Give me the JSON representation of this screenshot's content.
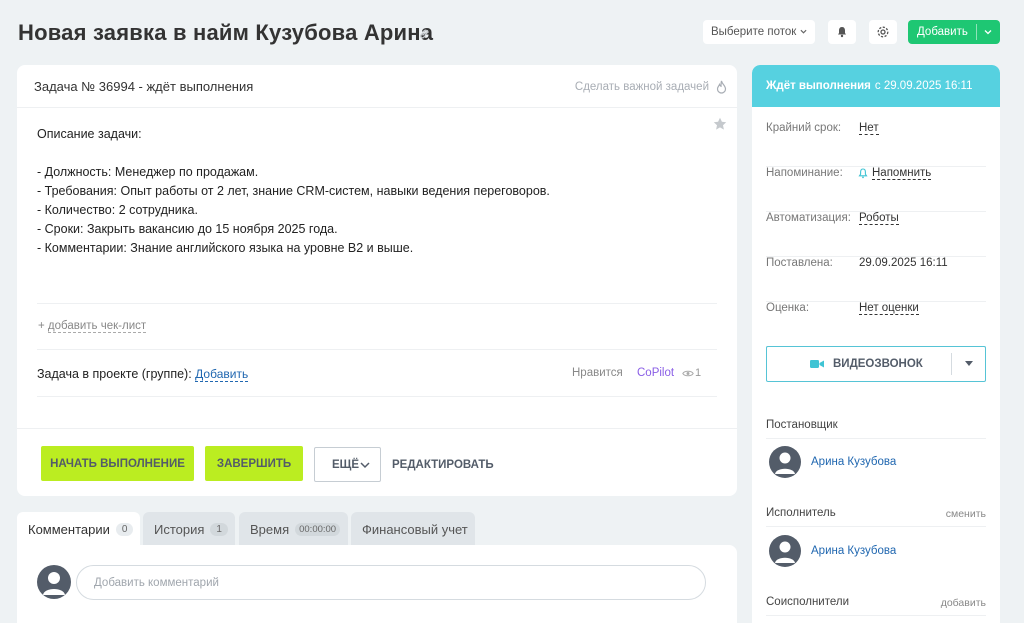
{
  "header": {
    "title": "Новая заявка в найм Кузубова Арина",
    "flow_select": "Выберите поток",
    "add_button": "Добавить"
  },
  "task": {
    "title": "Задача № 36994 - ждёт выполнения",
    "make_important": "Сделать важной задачей",
    "description": [
      "Описание задачи:",
      "",
      "- Должность: Менеджер по продажам.",
      "- Требования: Опыт работы от 2 лет, знание CRM-систем, навыки ведения переговоров.",
      "- Количество: 2 сотрудника.",
      "- Сроки: Закрыть вакансию до 15 ноября 2025 года.",
      "- Комментарии: Знание английского языка на уровне B2 и выше."
    ],
    "checklist_plus": "+",
    "checklist_link": "добавить чек-лист",
    "project_label": "Задача в проекте (группе):",
    "project_link": "Добавить",
    "likes": "Нравится",
    "copilot": "CoPilot",
    "views": "1",
    "buttons": {
      "start": "НАЧАТЬ ВЫПОЛНЕНИЕ",
      "finish": "ЗАВЕРШИТЬ",
      "more": "ЕЩЁ",
      "edit": "РЕДАКТИРОВАТЬ"
    }
  },
  "tabs": [
    {
      "label": "Комментарии",
      "badge": "0"
    },
    {
      "label": "История",
      "badge": "1"
    },
    {
      "label": "Время",
      "badge": "00:00:00"
    },
    {
      "label": "Финансовый учет",
      "badge": ""
    }
  ],
  "comment_placeholder": "Добавить комментарий",
  "sidebar": {
    "status_bold": "Ждёт выполнения",
    "status_rest": "с 29.09.2025 16:11",
    "props": [
      {
        "label": "Крайний срок:",
        "value": "Нет"
      },
      {
        "label": "Напоминание:",
        "value": "Напомнить"
      },
      {
        "label": "Автоматизация:",
        "value": "Роботы"
      },
      {
        "label": "Поставлена:",
        "value": "29.09.2025 16:11"
      },
      {
        "label": "Оценка:",
        "value": "Нет оценки"
      }
    ],
    "video_call": "ВИДЕОЗВОНОК",
    "creator_label": "Постановщик",
    "creator_name": "Арина Кузубова",
    "assignee_label": "Исполнитель",
    "assignee_action": "сменить",
    "assignee_name": "Арина Кузубова",
    "coexec_label": "Соисполнители",
    "coexec_action": "добавить"
  },
  "colors": {
    "accent_green": "#bbed21",
    "add_button": "#1ec773",
    "status_header": "#56d1e0",
    "link": "#2067b0"
  }
}
